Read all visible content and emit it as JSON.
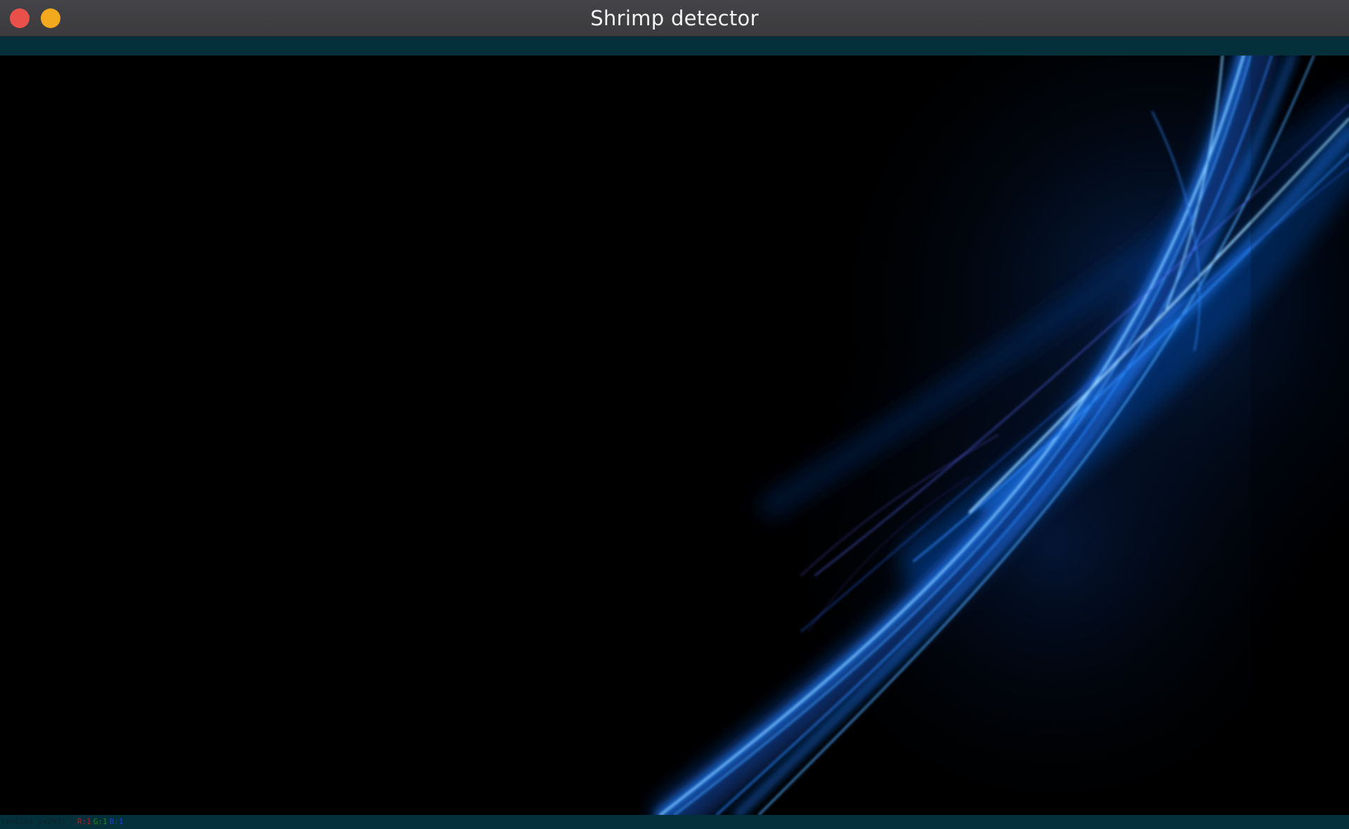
{
  "window": {
    "title": "Shrimp detector"
  },
  "colors": {
    "close": "#e9504a",
    "minimize": "#f3a91e",
    "bar_background": "#04303c",
    "image_accent": "#2f8cff"
  },
  "image": {
    "description_icon": "image-view-icon"
  },
  "status": {
    "coords": "(x=128) y=293) ~",
    "r": "R:1",
    "g": "G:1",
    "b": "B:1"
  }
}
